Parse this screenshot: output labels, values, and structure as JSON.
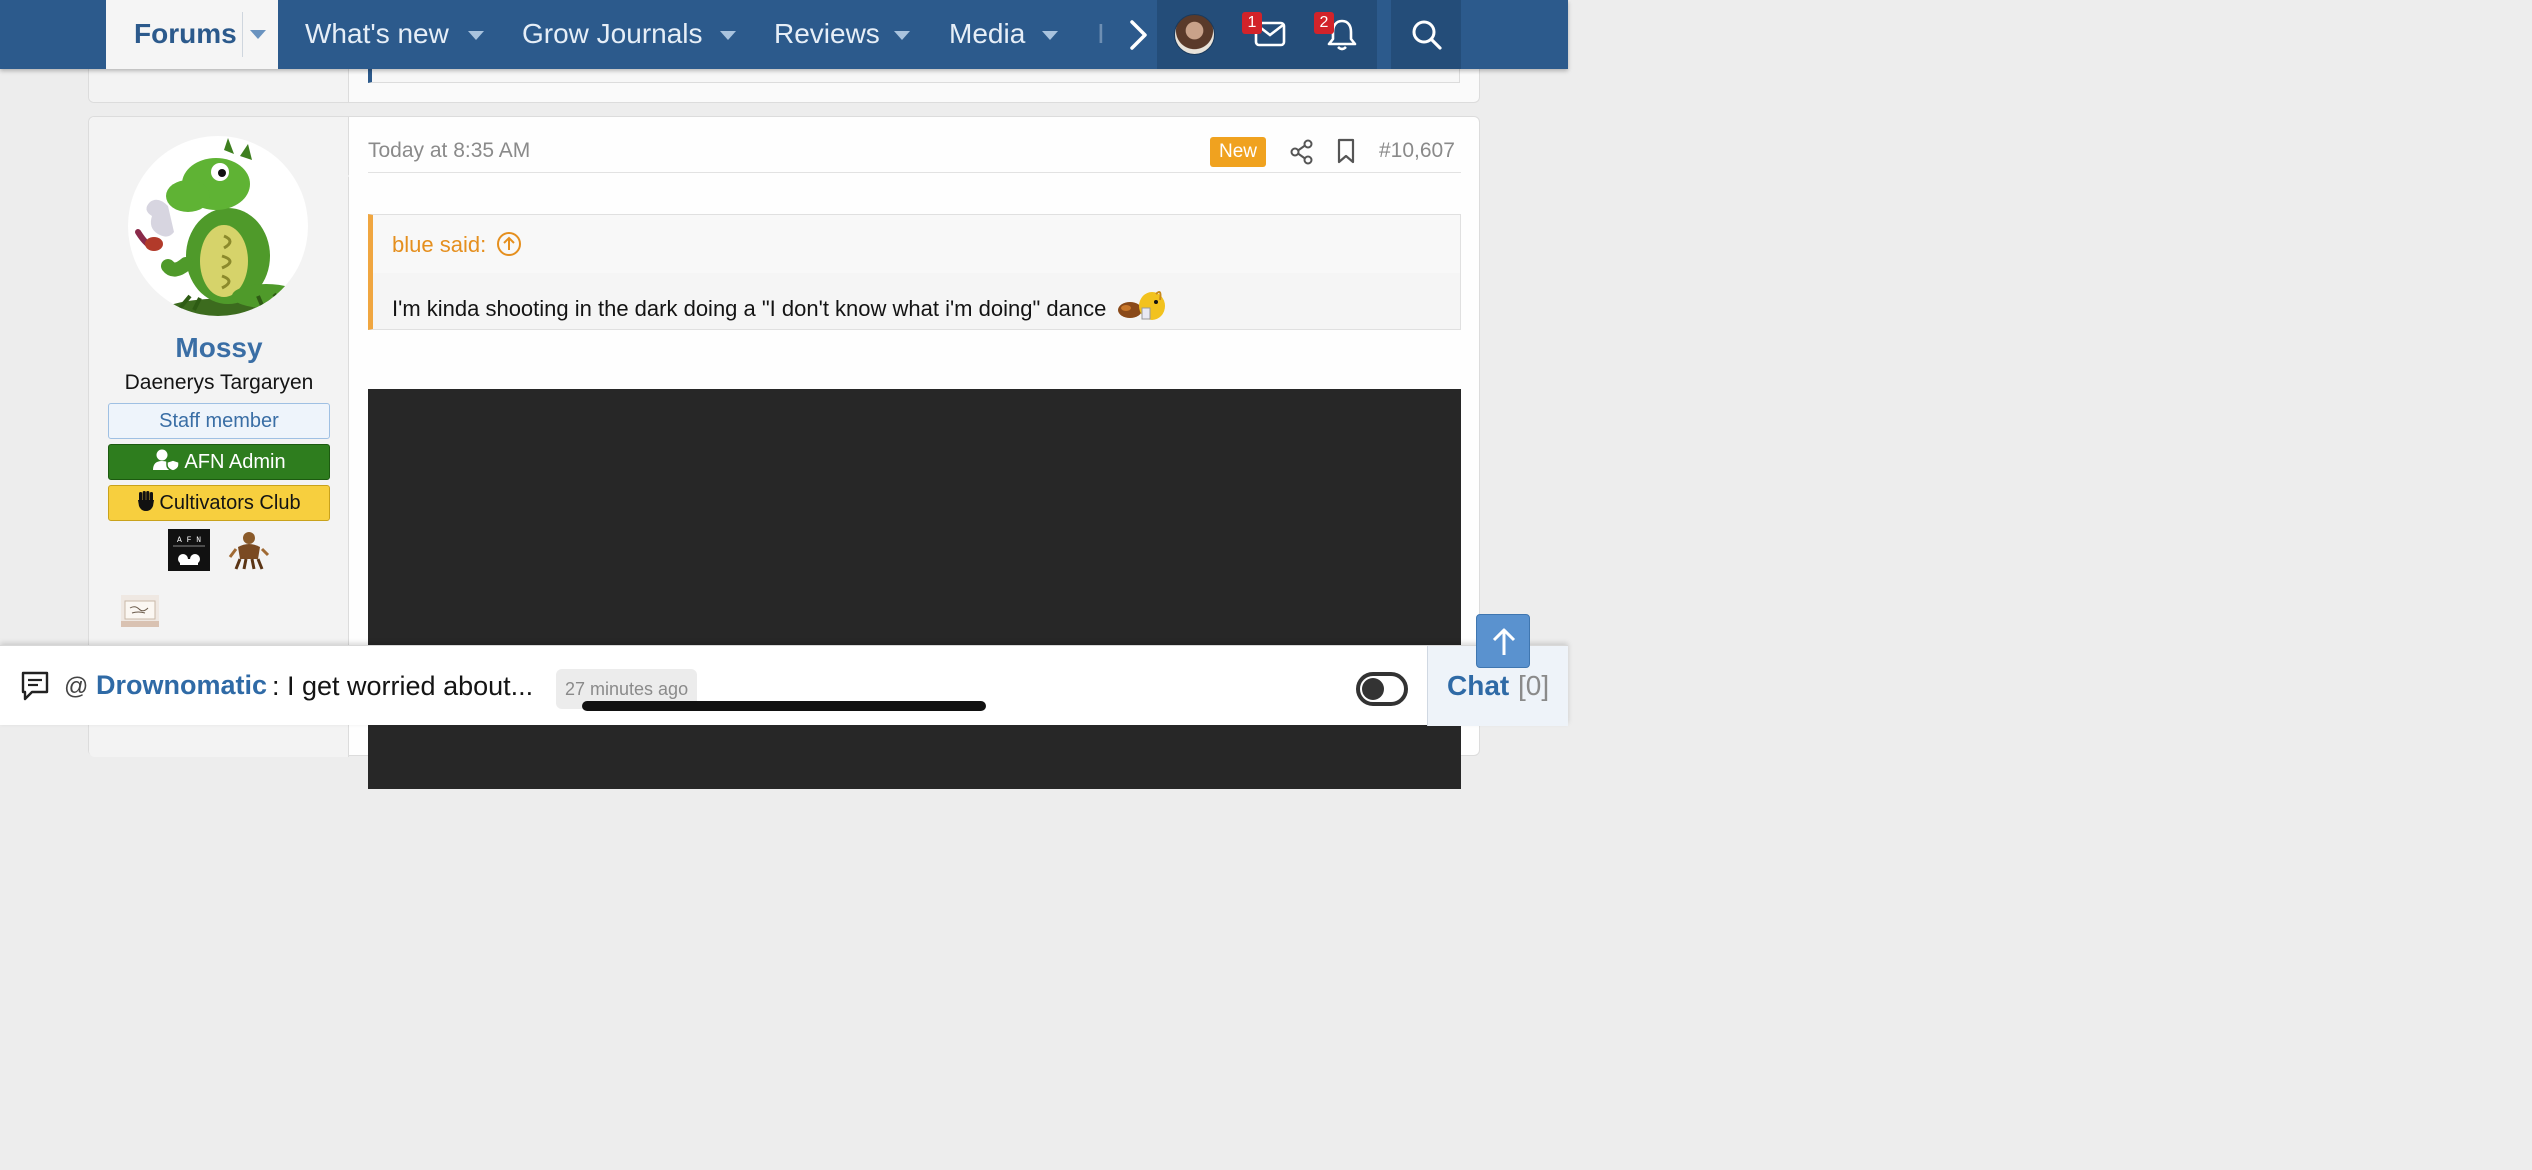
{
  "nav": {
    "forums_label": "Forums",
    "items": [
      {
        "label": "What's new"
      },
      {
        "label": "Grow Journals"
      },
      {
        "label": "Reviews"
      },
      {
        "label": "Media"
      }
    ],
    "more_partial": "I",
    "inbox_badge": "1",
    "alerts_badge": "2",
    "icons": [
      "chevron-right-icon",
      "avatar",
      "envelope-icon",
      "bell-icon",
      "search-icon"
    ]
  },
  "post": {
    "date": "Today at 8:35 AM",
    "new_label": "New",
    "number": "#10,607",
    "user": {
      "name": "Mossy",
      "title": "Daenerys Targaryen",
      "banners": {
        "staff": "Staff member",
        "admin": "AFN Admin",
        "club": "Cultivators Club"
      },
      "trophy_logo_text": "A F N"
    },
    "quote": {
      "author": "blue said:",
      "text": "I'm kinda shooting in the dark doing a \"I don't know what i'm doing\" dance"
    }
  },
  "chat": {
    "at": "@",
    "user": "Drownomatic",
    "message": ": I get worried about...",
    "time": "27 minutes ago",
    "tab_label": "Chat",
    "tab_count": "[0]"
  },
  "colors": {
    "nav_bg": "#2c5a8c",
    "accent_orange": "#f0a21f",
    "admin_green": "#2e7d1e",
    "club_yellow": "#f7cf3e",
    "link_blue": "#3a6ea5"
  }
}
